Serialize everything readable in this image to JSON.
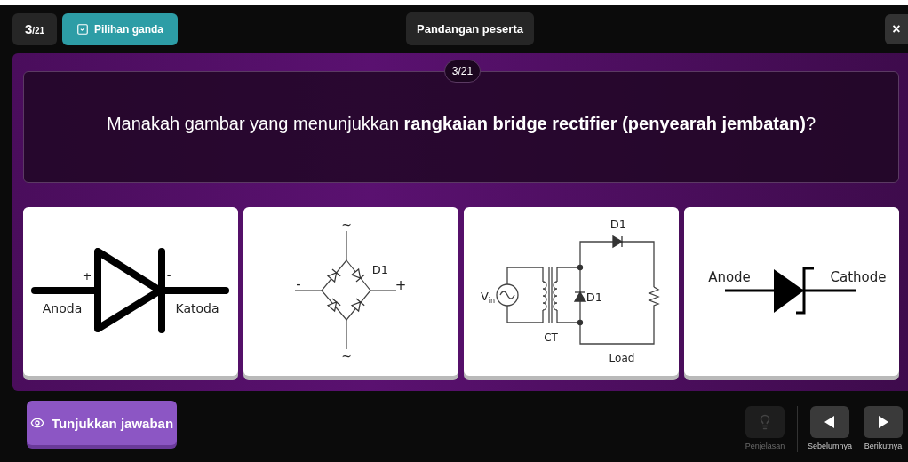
{
  "header": {
    "counter": {
      "current": "3",
      "total": "/21"
    },
    "question_type": "Pilihan ganda",
    "view_button": "Pandangan peserta",
    "close": "×"
  },
  "question": {
    "counter": "3/21",
    "text": "Manakah gambar yang menunjukkan **rangkaian bridge rectifier (penyearah jembatan)**?"
  },
  "options": [
    {
      "kind": "diode",
      "labels": [
        "+",
        "-",
        "Anoda",
        "Katoda"
      ]
    },
    {
      "kind": "bridge",
      "labels": [
        "~",
        "D1",
        "-",
        "+",
        "~"
      ]
    },
    {
      "kind": "center_tap",
      "labels": [
        "D1",
        "V$_{in}$",
        "D1",
        "CT",
        "Load"
      ]
    },
    {
      "kind": "schottky",
      "labels": [
        "Anode",
        "Cathode"
      ]
    }
  ],
  "footer": {
    "show_answer": "Tunjukkan jawaban",
    "controls": [
      {
        "kind": "hint",
        "label": "Penjelasan",
        "disabled": true
      },
      {
        "kind": "previous",
        "label": "Sebelumnya",
        "disabled": false
      },
      {
        "kind": "next",
        "label": "Berikutnya",
        "disabled": false
      }
    ]
  }
}
